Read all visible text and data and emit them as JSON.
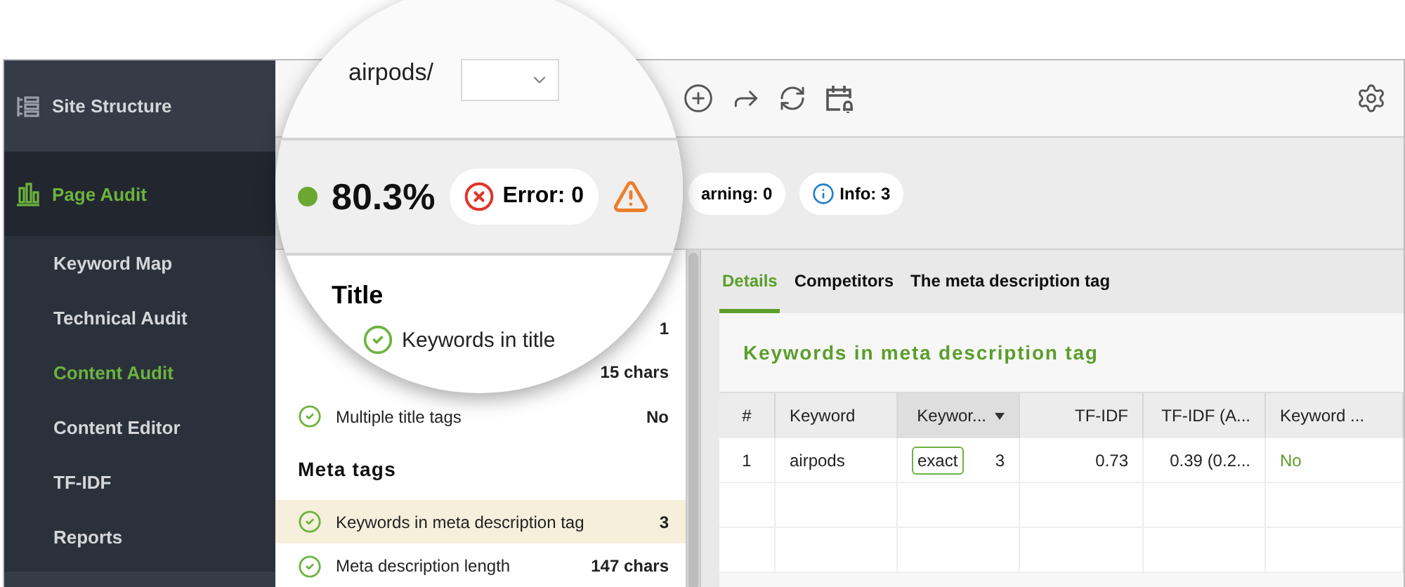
{
  "sidebar": {
    "items": [
      {
        "label": "Site Structure",
        "kind": "section",
        "selected": false
      },
      {
        "label": "Page Audit",
        "kind": "section",
        "selected": true
      },
      {
        "label": "Keyword Map",
        "kind": "sub",
        "selected": false
      },
      {
        "label": "Technical Audit",
        "kind": "sub",
        "selected": false
      },
      {
        "label": "Content Audit",
        "kind": "sub",
        "selected": true
      },
      {
        "label": "Content Editor",
        "kind": "sub",
        "selected": false
      },
      {
        "label": "TF-IDF",
        "kind": "sub",
        "selected": false
      },
      {
        "label": "Reports",
        "kind": "sub",
        "selected": false
      }
    ]
  },
  "magnifier": {
    "url": "airpods/",
    "score": "80.3%",
    "error": "Error: 0",
    "heading": "Title",
    "row_label": "Keywords in title"
  },
  "status_chips": [
    {
      "kind": "warning",
      "label": "arning: 0"
    },
    {
      "kind": "info",
      "label": "Info: 3"
    }
  ],
  "audit_sections": [
    {
      "rows": [
        {
          "value": "1",
          "selected": false
        },
        {
          "value": "15 chars",
          "selected": false
        },
        {
          "label": "Multiple title tags",
          "value": "No",
          "selected": false
        }
      ]
    },
    {
      "heading": "Meta tags",
      "rows": [
        {
          "label": "Keywords in meta description tag",
          "value": "3",
          "selected": true
        },
        {
          "label": "Meta description length",
          "value": "147 chars",
          "selected": false
        }
      ]
    }
  ],
  "tabs": [
    {
      "label": "Details",
      "selected": true
    },
    {
      "label": "Competitors",
      "selected": false
    },
    {
      "label": "The meta description tag",
      "selected": false
    }
  ],
  "card": {
    "title": "Keywords in meta description tag",
    "table": {
      "columns": [
        {
          "label": "#",
          "sorted": false
        },
        {
          "label": "Keyword",
          "sorted": false
        },
        {
          "label": "Keywor...",
          "sorted": true
        },
        {
          "label": "TF-IDF",
          "sorted": false
        },
        {
          "label": "TF-IDF (A...",
          "sorted": false
        },
        {
          "label": "Keyword ...",
          "sorted": false
        }
      ],
      "rows": [
        {
          "index": "1",
          "keyword": "airpods",
          "tag": "exact",
          "count": "3",
          "tfidf": "0.73",
          "tfidf_avg": "0.39 (0.2...",
          "status": "No"
        }
      ]
    }
  }
}
